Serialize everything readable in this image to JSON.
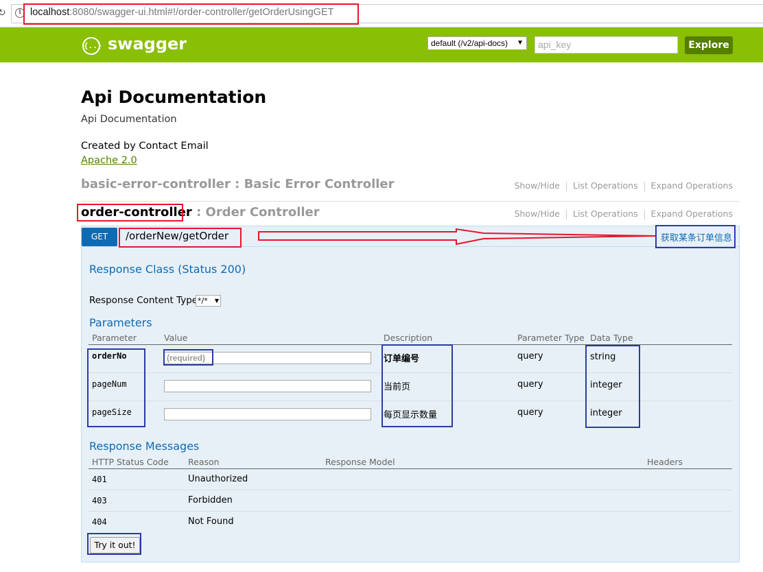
{
  "browser": {
    "url_host": "localhost",
    "url_rest": ":8080/swagger-ui.html#!/order-controller/getOrderUsingGET"
  },
  "header": {
    "logo_text": "swagger",
    "spec_select": "default (/v2/api-docs)",
    "api_key_placeholder": "api_key",
    "explore_label": "Explore",
    "brand_color": "#89bf04"
  },
  "info": {
    "title": "Api Documentation",
    "description": "Api Documentation",
    "created_by": "Created by Contact Email",
    "license": "Apache 2.0"
  },
  "controllers": [
    {
      "name": "basic-error-controller",
      "label": " : Basic Error Controller",
      "show_hide": "Show/Hide",
      "list_ops": "List Operations",
      "expand_ops": "Expand Operations"
    },
    {
      "name": "order-controller",
      "label": " : Order Controller",
      "show_hide": "Show/Hide",
      "list_ops": "List Operations",
      "expand_ops": "Expand Operations"
    }
  ],
  "operation": {
    "method": "GET",
    "path": "/orderNew/getOrder",
    "summary": "获取某条订单信息",
    "response_class_title": "Response Class (Status 200)",
    "response_content_type_label": "Response Content Type",
    "response_content_type_value": "*/*",
    "parameters_title": "Parameters",
    "param_headers": [
      "Parameter",
      "Value",
      "Description",
      "Parameter Type",
      "Data Type"
    ],
    "params": [
      {
        "name": "orderNo",
        "value_placeholder": "(required)",
        "description": "订单编号",
        "param_type": "query",
        "data_type": "string"
      },
      {
        "name": "pageNum",
        "value_placeholder": "",
        "description": "当前页",
        "param_type": "query",
        "data_type": "integer"
      },
      {
        "name": "pageSize",
        "value_placeholder": "",
        "description": "每页显示数量",
        "param_type": "query",
        "data_type": "integer"
      }
    ],
    "response_messages_title": "Response Messages",
    "msg_headers": [
      "HTTP Status Code",
      "Reason",
      "Response Model",
      "Headers"
    ],
    "messages": [
      {
        "code": "401",
        "reason": "Unauthorized"
      },
      {
        "code": "403",
        "reason": "Forbidden"
      },
      {
        "code": "404",
        "reason": "Not Found"
      }
    ],
    "try_label": "Try it out!"
  },
  "colors": {
    "get_blue": "#0f6ab4",
    "annotation_red": "#e8142a",
    "annotation_blue": "#2b3aa8"
  }
}
